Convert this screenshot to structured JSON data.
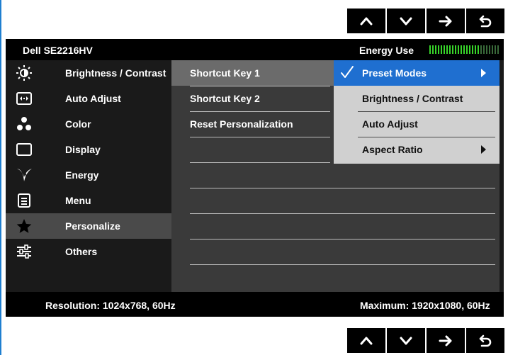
{
  "nav_buttons": {
    "top": [
      "up-arrow",
      "down-arrow",
      "right-arrow",
      "return-arrow"
    ],
    "bottom": [
      "up-arrow",
      "down-arrow",
      "right-arrow",
      "return-arrow"
    ]
  },
  "header": {
    "model": "Dell SE2216HV",
    "energy_label": "Energy Use",
    "energy_level": 0.7
  },
  "left_menu": {
    "items": [
      {
        "label": "Brightness / Contrast",
        "icon": "brightness-icon"
      },
      {
        "label": "Auto Adjust",
        "icon": "auto-adjust-icon"
      },
      {
        "label": "Color",
        "icon": "color-icon"
      },
      {
        "label": "Display",
        "icon": "display-icon"
      },
      {
        "label": "Energy",
        "icon": "energy-icon"
      },
      {
        "label": "Menu",
        "icon": "menu-icon"
      },
      {
        "label": "Personalize",
        "icon": "star-icon"
      },
      {
        "label": "Others",
        "icon": "others-icon"
      }
    ],
    "active": "Personalize"
  },
  "middle_menu": {
    "items": [
      {
        "label": "Shortcut Key 1"
      },
      {
        "label": "Shortcut Key 2"
      },
      {
        "label": "Reset Personalization"
      }
    ],
    "active": "Shortcut Key 1"
  },
  "submenu": {
    "items": [
      {
        "label": "Preset Modes",
        "selected": true,
        "has_submenu": true
      },
      {
        "label": "Brightness / Contrast",
        "selected": false,
        "has_submenu": false
      },
      {
        "label": "Auto Adjust",
        "selected": false,
        "has_submenu": false
      },
      {
        "label": "Aspect Ratio",
        "selected": false,
        "has_submenu": true
      }
    ]
  },
  "status": {
    "resolution": "Resolution: 1024x768, 60Hz",
    "maximum": "Maximum: 1920x1080, 60Hz"
  },
  "colors": {
    "selection_blue": "#1f6fd0",
    "energy_green": "#38d62a",
    "frame_blue": "#1f7fd0"
  }
}
